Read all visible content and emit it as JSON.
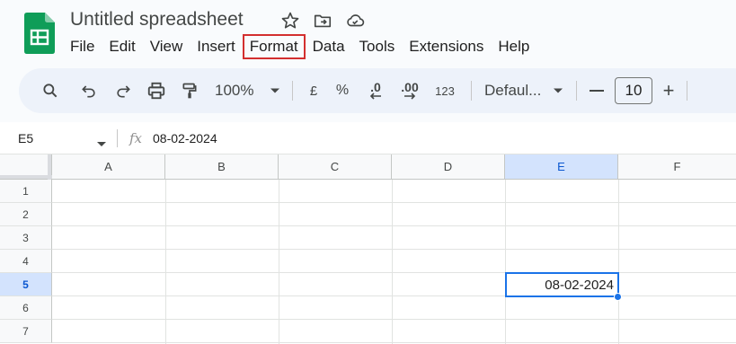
{
  "document": {
    "title": "Untitled spreadsheet"
  },
  "header_icons": [
    "star-icon",
    "move-to-folder-icon",
    "cloud-status-icon"
  ],
  "menu": [
    {
      "label": "File",
      "highlighted": false
    },
    {
      "label": "Edit",
      "highlighted": false
    },
    {
      "label": "View",
      "highlighted": false
    },
    {
      "label": "Insert",
      "highlighted": false
    },
    {
      "label": "Format",
      "highlighted": true
    },
    {
      "label": "Data",
      "highlighted": false
    },
    {
      "label": "Tools",
      "highlighted": false
    },
    {
      "label": "Extensions",
      "highlighted": false
    },
    {
      "label": "Help",
      "highlighted": false
    }
  ],
  "toolbar": {
    "zoom": "100%",
    "currency": "£",
    "percent": "%",
    "decrease_decimal": ".0",
    "increase_decimal": ".00",
    "number_format": "123",
    "font": "Defaul...",
    "font_size": "10",
    "minus": "—",
    "plus": "+"
  },
  "formula_bar": {
    "cell_ref": "E5",
    "fx": "fx",
    "value": "08-02-2024"
  },
  "grid": {
    "columns": [
      "A",
      "B",
      "C",
      "D",
      "E",
      "F"
    ],
    "rows": [
      "1",
      "2",
      "3",
      "4",
      "5",
      "6",
      "7"
    ],
    "active_column": "E",
    "active_row": "5",
    "selected_cell_value": "08-02-2024"
  },
  "colors": {
    "accent": "#1a73e8",
    "highlight_outline": "#d32f2f",
    "active_header_bg": "#d3e3fd"
  }
}
